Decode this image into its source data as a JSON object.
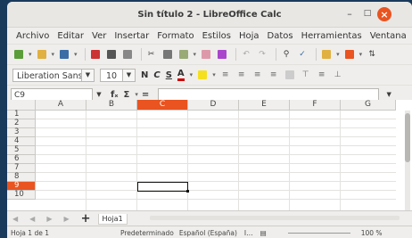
{
  "window": {
    "title": "Sin título 2 - LibreOffice Calc"
  },
  "menu": [
    "Archivo",
    "Editar",
    "Ver",
    "Insertar",
    "Formato",
    "Estilos",
    "Hoja",
    "Datos",
    "Herramientas",
    "Ventana"
  ],
  "format": {
    "font_name": "Liberation Sans",
    "font_size": "10"
  },
  "formula": {
    "cell_ref": "C9",
    "input_value": ""
  },
  "columns": [
    "A",
    "B",
    "C",
    "D",
    "E",
    "F",
    "G"
  ],
  "rows": [
    "1",
    "2",
    "3",
    "4",
    "5",
    "6",
    "7",
    "8",
    "9",
    "10"
  ],
  "selection": {
    "column": "C",
    "row": "9"
  },
  "sheet_tabs": [
    "Hoja1"
  ],
  "status": {
    "sheet_info": "Hoja 1 de 1",
    "page_style": "Predeterminado",
    "language": "Español (España)",
    "zoom": "100 %"
  },
  "colors": {
    "accent": "#e95420"
  }
}
